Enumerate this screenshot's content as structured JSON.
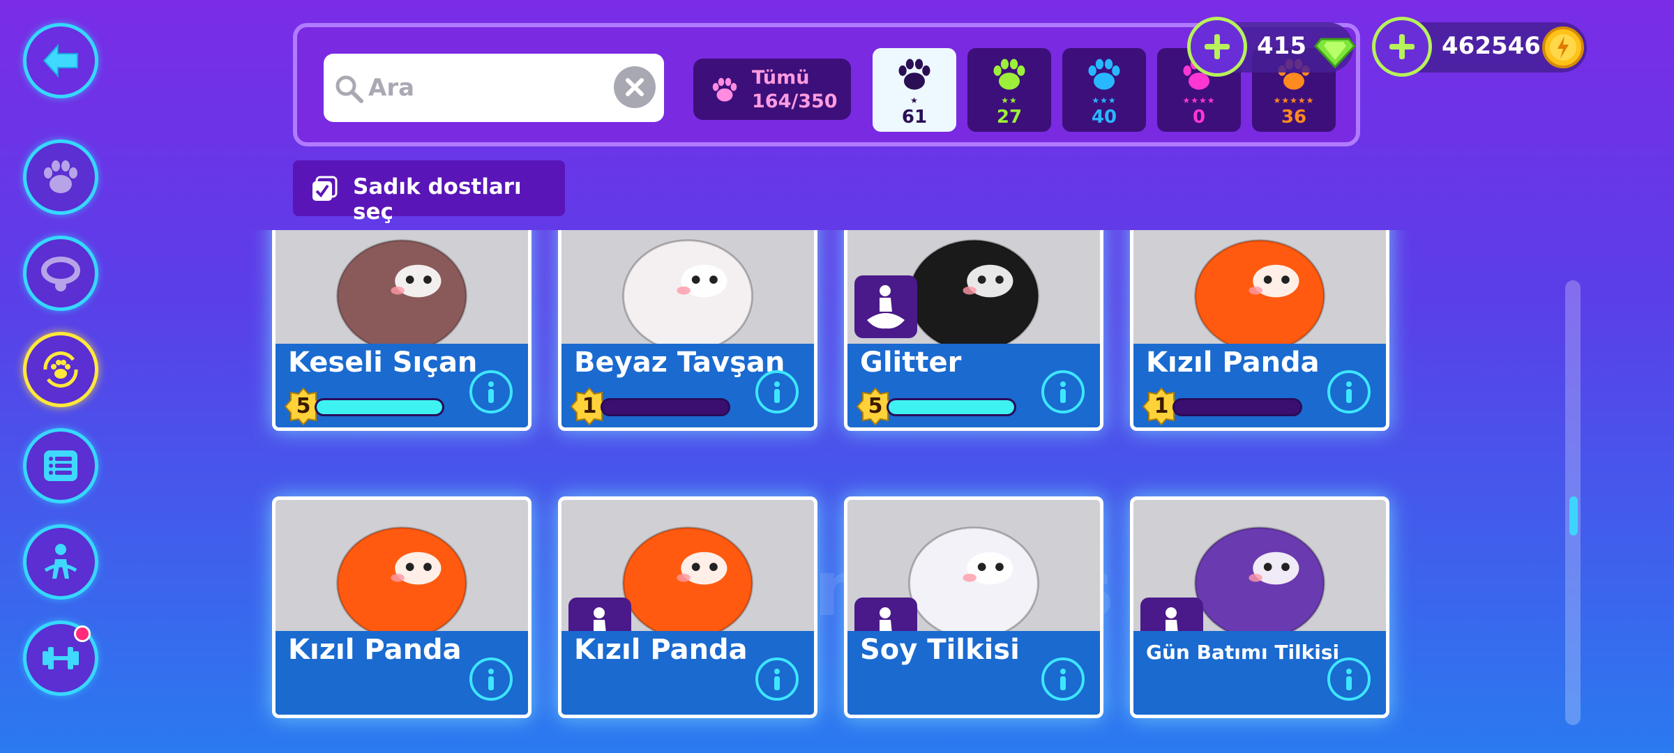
{
  "search": {
    "placeholder": "Ara",
    "value": ""
  },
  "filter_all": {
    "label": "Tümü",
    "count": "164/350"
  },
  "rarity_filters": [
    {
      "stars": "★",
      "count": "61",
      "color": "#2a0f55"
    },
    {
      "stars": "★★",
      "count": "27",
      "color": "#9cf03a"
    },
    {
      "stars": "★★★",
      "count": "40",
      "color": "#28b8ff"
    },
    {
      "stars": "★★★★",
      "count": "0",
      "color": "#ff37d2"
    },
    {
      "stars": "★★★★★",
      "count": "36",
      "color": "#ff8a1f"
    }
  ],
  "currency": {
    "gems": "415",
    "coins": "462546"
  },
  "loyal_toggle": {
    "label": "Sadık dostları seç"
  },
  "watermark": "itemsatis",
  "pets": [
    {
      "name": "Keseli Sıçan",
      "level": "5",
      "progress": 1.0,
      "ride": false,
      "color": "#8a5a5a"
    },
    {
      "name": "Beyaz Tavşan",
      "level": "1",
      "progress": 0.0,
      "ride": false,
      "color": "#f4f0f2"
    },
    {
      "name": "Glitter",
      "level": "5",
      "progress": 1.0,
      "ride": true,
      "color": "#1a1a1a"
    },
    {
      "name": "Kızıl Panda",
      "level": "1",
      "progress": 0.0,
      "ride": false,
      "color": "#ff5a10"
    },
    {
      "name": "Kızıl Panda",
      "level": "",
      "progress": null,
      "ride": false,
      "color": "#ff5a10"
    },
    {
      "name": "Kızıl Panda",
      "level": "",
      "progress": null,
      "ride": true,
      "color": "#ff5a10"
    },
    {
      "name": "Soy Tilkisi",
      "level": "",
      "progress": null,
      "ride": true,
      "color": "#f2f2f8"
    },
    {
      "name": "Gün Batımı Tilkisi",
      "level": "",
      "progress": null,
      "ride": true,
      "color": "#6a3ab0"
    }
  ]
}
